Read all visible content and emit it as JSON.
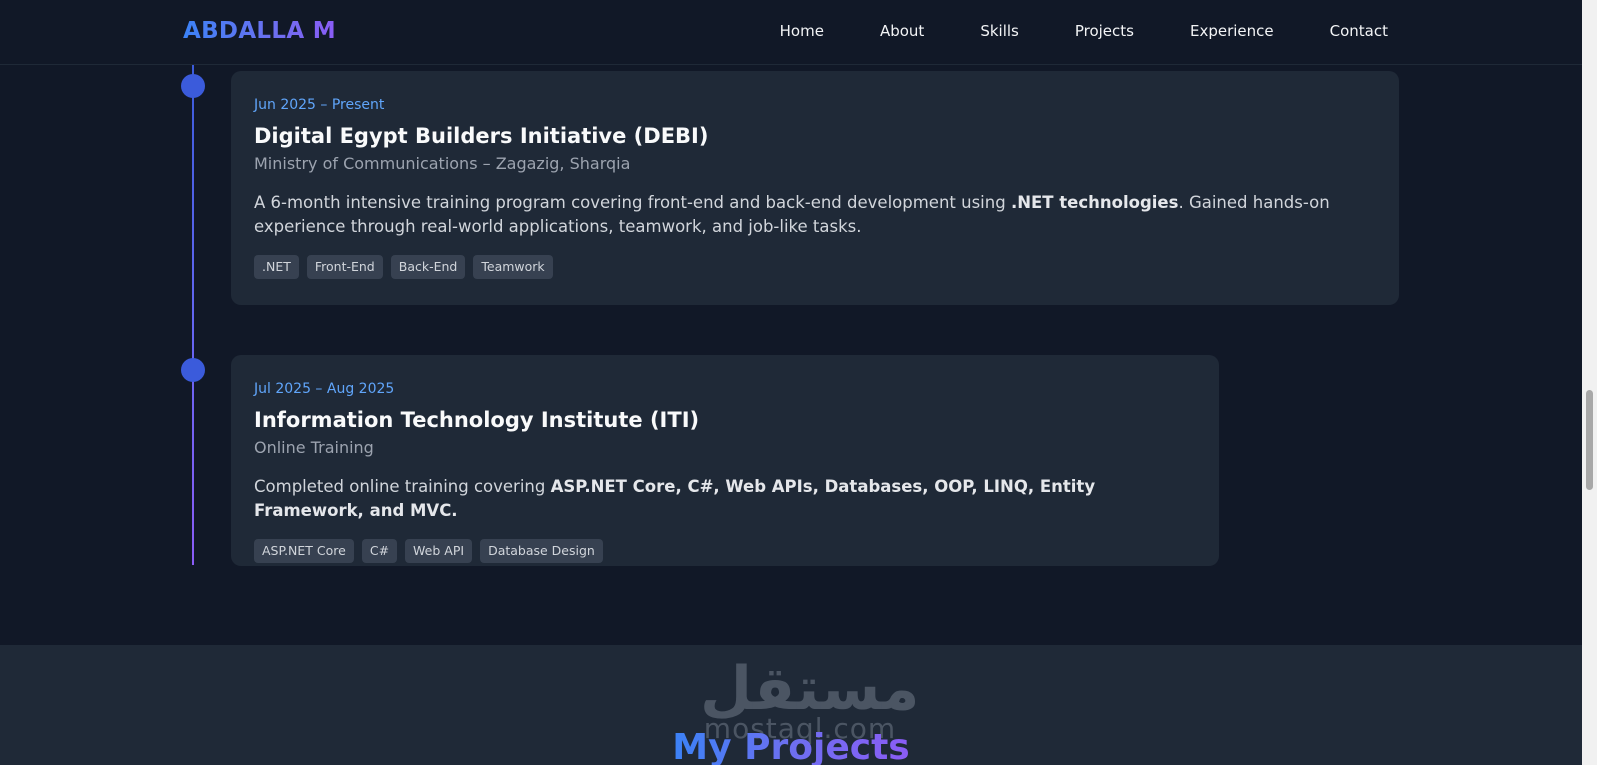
{
  "navbar": {
    "logo": "ABDALLA M",
    "links": [
      "Home",
      "About",
      "Skills",
      "Projects",
      "Experience",
      "Contact"
    ]
  },
  "experience": [
    {
      "date": "Jun 2025 – Present",
      "title": "Digital Egypt Builders Initiative (DEBI)",
      "subtitle": "Ministry of Communications – Zagazig, Sharqia",
      "desc_before": "A 6-month intensive training program covering front-end and back-end development using ",
      "desc_bold": ".NET technologies",
      "desc_after": ". Gained hands-on experience through real-world applications, teamwork, and job-like tasks.",
      "tags": [
        ".NET",
        "Front-End",
        "Back-End",
        "Teamwork"
      ]
    },
    {
      "date": "Jul 2025 – Aug 2025",
      "title": "Information Technology Institute (ITI)",
      "subtitle": "Online Training",
      "desc_before": "Completed online training covering ",
      "desc_bold": "ASP.NET Core, C#, Web APIs, Databases, OOP, LINQ, Entity Framework, and MVC.",
      "desc_after": "",
      "tags": [
        "ASP.NET Core",
        "C#",
        "Web API",
        "Database Design"
      ]
    }
  ],
  "projects": {
    "title": "My Projects",
    "watermark_arabic": "مستقل",
    "watermark_latin": "mostaql.com"
  }
}
